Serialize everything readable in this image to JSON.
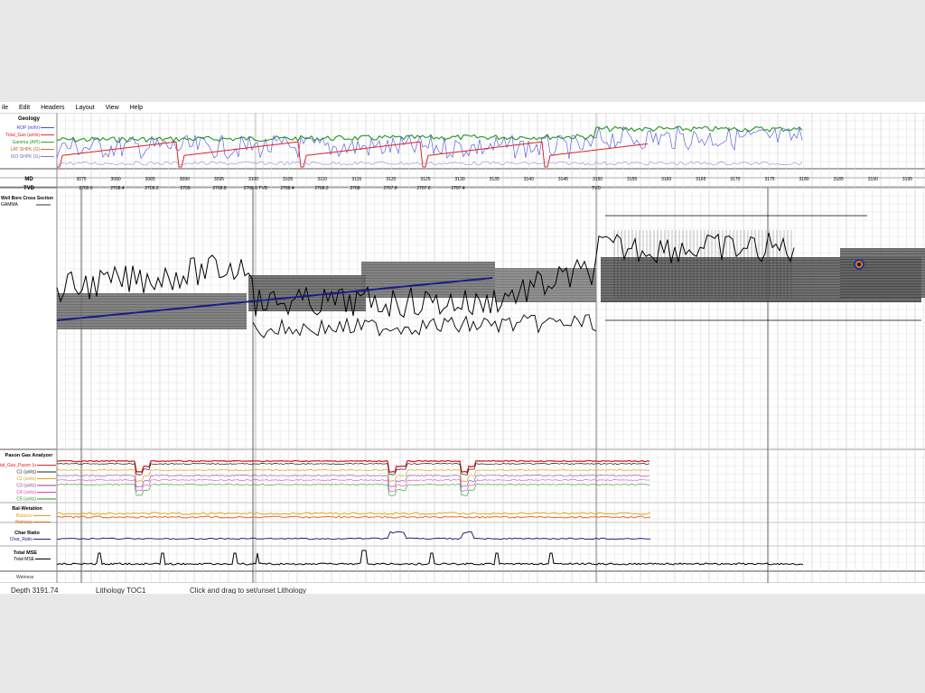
{
  "menu": [
    "ile",
    "Edit",
    "Headers",
    "Layout",
    "View",
    "Help"
  ],
  "geology": {
    "title": "Geology",
    "legend": [
      {
        "label": "ROP (m/hr)",
        "color": "#3a3ad0"
      },
      {
        "label": "Total_Gas (units)",
        "color": "#e02020"
      },
      {
        "label": "Gamma (API)",
        "color": "#1f9a1f"
      },
      {
        "label": "LAT SHPK (G)",
        "color": "#c06020"
      },
      {
        "label": "ISO SHPK (G)",
        "color": "#6a6ad0"
      }
    ]
  },
  "md_label": "MD",
  "tvd_label": "TVD",
  "md_ticks": [
    "3075",
    "3080",
    "3085",
    "3090",
    "3095",
    "3100",
    "3105",
    "3110",
    "3115",
    "3120",
    "3125",
    "3130",
    "3135",
    "3140",
    "3145",
    "3150",
    "3155",
    "3160",
    "3165",
    "3170",
    "3175",
    "3180",
    "3185",
    "3190",
    "3195"
  ],
  "tvd_ticks": [
    "2709.6",
    "2708.4",
    "2709.2",
    "2709",
    "2708.8",
    "2708.6 TVD",
    "2708.4",
    "2708.2",
    "2708",
    "2707.8",
    "2707.6",
    "2707.4",
    "TVD"
  ],
  "wellbore": {
    "title": "Well Bore Cross Section",
    "sub": "GAMMA"
  },
  "pason": {
    "title": "Pason Gas Analyzer",
    "legend": [
      {
        "label": "Total_Gas_Pason (u",
        "color": "#e02020"
      },
      {
        "label": "C1 (units)",
        "color": "#202020"
      },
      {
        "label": "C2 (units)",
        "color": "#e0a020"
      },
      {
        "label": "C3 (units)",
        "color": "#8040a0"
      },
      {
        "label": "C4 (units)",
        "color": "#e040c0"
      },
      {
        "label": "C5 (units)",
        "color": "#1f9a1f"
      }
    ]
  },
  "balwet": {
    "title": "Bal-Wetation",
    "legend": [
      {
        "label": "Balance",
        "color": "#e0a020"
      },
      {
        "label": "Wetness",
        "color": "#e07020"
      }
    ]
  },
  "charratio": {
    "title": "Char Ratio",
    "legend": [
      {
        "label": "Char_Ratio",
        "color": "#202080"
      }
    ]
  },
  "mse": {
    "title": "Total MSE",
    "legend": [
      {
        "label": "Total MSE",
        "color": "#000000"
      }
    ],
    "cut": "Wetness"
  },
  "status": {
    "depth": "Depth  3191.74",
    "lith": "Lithology  TOC1",
    "hint": "Click and drag to set/unset Lithology"
  }
}
